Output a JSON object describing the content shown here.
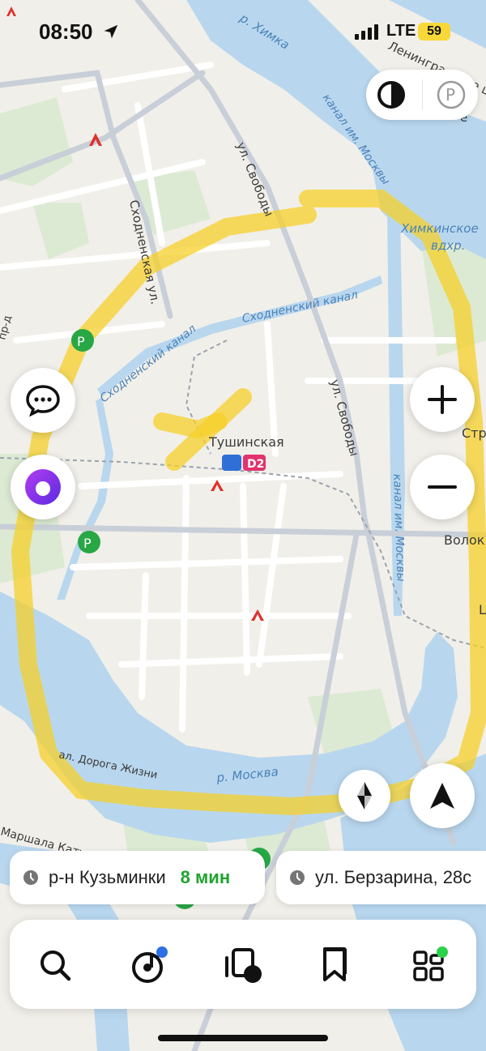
{
  "status_bar": {
    "time": "08:50",
    "network": "LTE",
    "battery": "59"
  },
  "map": {
    "labels": {
      "river_khimka": "р. Химка",
      "canal_moscow_top": "канал им. Москвы",
      "khimki_reservoir": "Химкинское",
      "khimki_reservoir_2": "вдхр.",
      "street_svobody_top": "ул. Свободы",
      "street_skhodnenskaya": "Сходненская ул.",
      "canal_skhodnensky_right": "Сходненский канал",
      "canal_skhodnensky_left": "Сходненский канал",
      "street_svobody_mid": "ул. Свободы",
      "station_tushinskaya": "Тушинская",
      "d2_badge": "D2",
      "canal_moscow_right": "канал им. Москвы",
      "volok": "Волок",
      "river_moskva": "р. Москва",
      "road_zhizni": "ал. Дорога Жизни",
      "leningradskoe": "Ленинградское ш.",
      "marshala_kat": "Маршала Кату",
      "str_partial": "Стр",
      "ts_partial": "Ц",
      "pr_d": "пр-д",
      "ye_partial": "е"
    }
  },
  "destinations": [
    {
      "name": "р-н Кузьминки",
      "eta": "8 мин"
    },
    {
      "name": "ул. Берзарина, 28с"
    }
  ],
  "icons": {
    "top_controls": [
      "theme-icon",
      "parking-icon"
    ],
    "left": [
      "chat-icon",
      "alice-icon"
    ],
    "right": [
      "zoom-in-icon",
      "zoom-out-icon"
    ],
    "bottom_right": [
      "compass-icon",
      "navigate-icon"
    ],
    "nav": [
      "search-icon",
      "music-icon",
      "transport-icon",
      "bookmarks-icon",
      "services-icon"
    ]
  },
  "colors": {
    "water": "#b8d7ef",
    "highlight": "#f5d02a",
    "eta": "#1fa32e",
    "metro": "#e0312b",
    "d2": "#e2336f"
  }
}
